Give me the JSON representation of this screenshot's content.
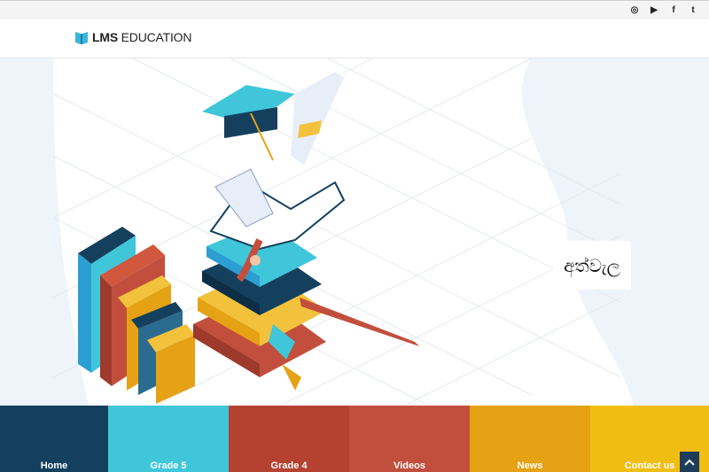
{
  "brand": {
    "bold": "LMS",
    "rest": " EDUCATION"
  },
  "social": [
    {
      "name": "instagram-icon",
      "glyph": "◎"
    },
    {
      "name": "youtube-icon",
      "glyph": "▶"
    },
    {
      "name": "facebook-icon",
      "glyph": "f"
    },
    {
      "name": "twitter-icon",
      "glyph": "t"
    }
  ],
  "hero": {
    "word": "අත්වැල"
  },
  "nav": [
    {
      "label": "Home",
      "color": "#14405e"
    },
    {
      "label": "Grade 5",
      "color": "#40c6d9"
    },
    {
      "label": "Grade 4",
      "color": "#b54131"
    },
    {
      "label": "Videos",
      "color": "#c24f3d"
    },
    {
      "label": "News",
      "color": "#e5a215"
    },
    {
      "label": "Contact us",
      "color": "#f0bd13"
    }
  ]
}
